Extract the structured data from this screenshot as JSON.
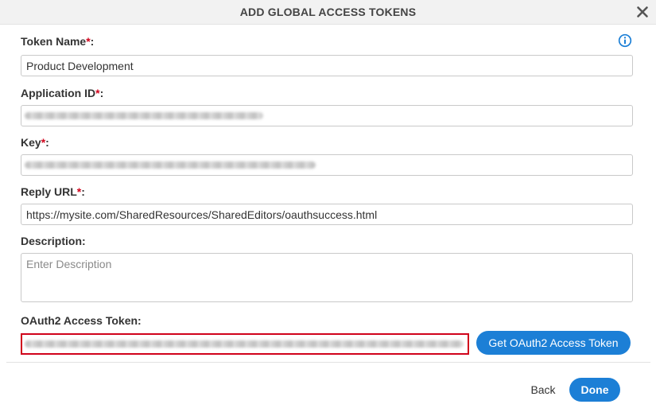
{
  "dialog": {
    "title": "ADD GLOBAL ACCESS TOKENS",
    "close_icon": "close-icon",
    "info_icon": "info-icon"
  },
  "form": {
    "token_name": {
      "label": "Token Name",
      "required_mark": "*",
      "suffix": ":",
      "value": "Product Development"
    },
    "application_id": {
      "label": "Application ID",
      "required_mark": "*",
      "suffix": ":"
    },
    "key": {
      "label": "Key",
      "required_mark": "*",
      "suffix": ":"
    },
    "reply_url": {
      "label": "Reply URL",
      "required_mark": "*",
      "suffix": ":",
      "value": "https://mysite.com/SharedResources/SharedEditors/oauthsuccess.html"
    },
    "description": {
      "label": "Description:",
      "placeholder": "Enter Description",
      "value": ""
    },
    "oauth2_token": {
      "label": "OAuth2 Access Token:"
    }
  },
  "buttons": {
    "get_token": "Get OAuth2 Access Token",
    "back": "Back",
    "done": "Done"
  },
  "colors": {
    "accent": "#1c7fd6",
    "required": "#d0021b",
    "highlight_border": "#d0021b",
    "header_bg": "#f2f2f2"
  }
}
